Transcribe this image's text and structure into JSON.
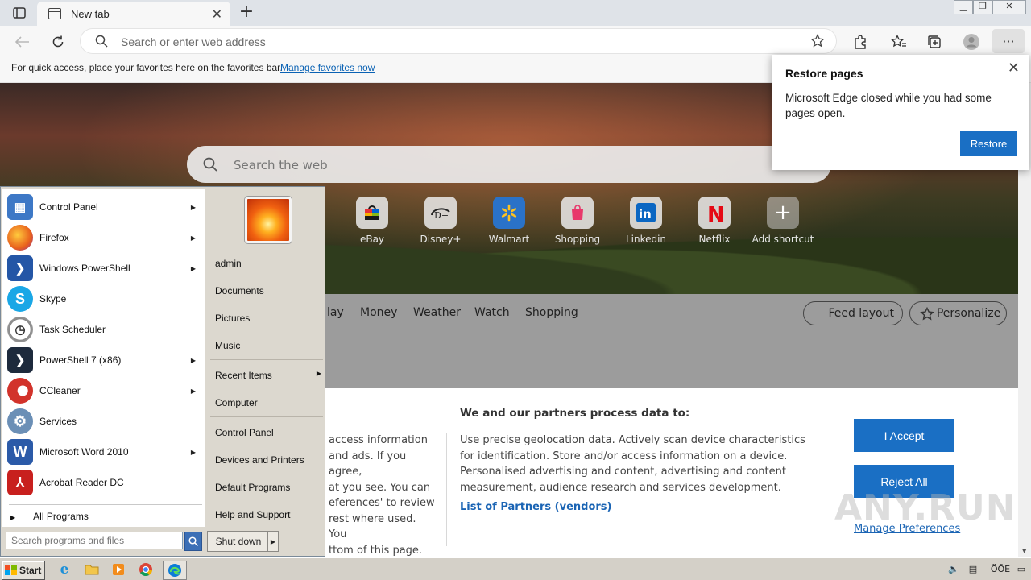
{
  "browser": {
    "tab_title": "New tab",
    "address_placeholder": "Search or enter web address",
    "favorites_bar_text": "For quick access, place your favorites here on the favorites bar.",
    "favorites_bar_link": "Manage favorites now"
  },
  "newtab": {
    "search_placeholder": "Search the web",
    "shortcuts": [
      {
        "label": "eBay",
        "icon": "ebay-icon"
      },
      {
        "label": "Disney+",
        "icon": "disney-icon"
      },
      {
        "label": "Walmart",
        "icon": "walmart-icon"
      },
      {
        "label": "Shopping",
        "icon": "shopping-icon"
      },
      {
        "label": "Linkedin",
        "icon": "linkedin-icon"
      },
      {
        "label": "Netflix",
        "icon": "netflix-icon"
      },
      {
        "label": "Add shortcut",
        "icon": "plus-icon"
      }
    ],
    "feed_tabs": [
      "lay",
      "Money",
      "Weather",
      "Watch",
      "Shopping"
    ],
    "feed_layout_label": "Feed layout",
    "personalize_label": "Personalize"
  },
  "consent": {
    "left_partial": "access information\nand ads. If you agree,\nat you see. You can\neferences' to review\nrest where used.  You\nttom of this page.",
    "heading": "We and our partners process data to:",
    "body": "Use precise geolocation data. Actively scan device characteristics for identification. Store and/or access information on a device. Personalised advertising and content, advertising and content measurement, audience research and services development.",
    "partners_link": "List of Partners (vendors)",
    "accept_label": "I Accept",
    "reject_label": "Reject All",
    "manage_label": "Manage Preferences"
  },
  "restore_popup": {
    "title": "Restore pages",
    "message": "Microsoft Edge closed while you had some pages open.",
    "button": "Restore"
  },
  "start_menu": {
    "programs": [
      {
        "label": "Control Panel",
        "icon": "control-panel-icon",
        "arrow": true,
        "color": "#3d78c6"
      },
      {
        "label": "Firefox",
        "icon": "firefox-icon",
        "arrow": true,
        "color": "#e8601c"
      },
      {
        "label": "Windows PowerShell",
        "icon": "powershell-icon",
        "arrow": true,
        "color": "#2456a6"
      },
      {
        "label": "Skype",
        "icon": "skype-icon",
        "arrow": false,
        "color": "#1aa7e6"
      },
      {
        "label": "Task Scheduler",
        "icon": "task-scheduler-icon",
        "arrow": false,
        "color": "#8a8a8a"
      },
      {
        "label": "PowerShell 7 (x86)",
        "icon": "powershell7-icon",
        "arrow": true,
        "color": "#1d2a3c"
      },
      {
        "label": "CCleaner",
        "icon": "ccleaner-icon",
        "arrow": true,
        "color": "#d2332b"
      },
      {
        "label": "Services",
        "icon": "services-icon",
        "arrow": false,
        "color": "#6b8fb6"
      },
      {
        "label": "Microsoft Word 2010",
        "icon": "word-icon",
        "arrow": true,
        "color": "#2b5aa8"
      },
      {
        "label": "Acrobat Reader DC",
        "icon": "acrobat-icon",
        "arrow": false,
        "color": "#c8201e"
      }
    ],
    "all_programs": "All Programs",
    "search_placeholder": "Search programs and files",
    "right_items": {
      "user": "admin",
      "documents": "Documents",
      "pictures": "Pictures",
      "music": "Music",
      "recent": "Recent Items",
      "computer": "Computer",
      "control_panel": "Control Panel",
      "devices": "Devices and Printers",
      "defaults": "Default Programs",
      "help": "Help and Support"
    },
    "shutdown": "Shut down"
  },
  "taskbar": {
    "start_label": "Start",
    "tray_lang": "ÖÕE"
  },
  "watermark": "ANY.RUN"
}
